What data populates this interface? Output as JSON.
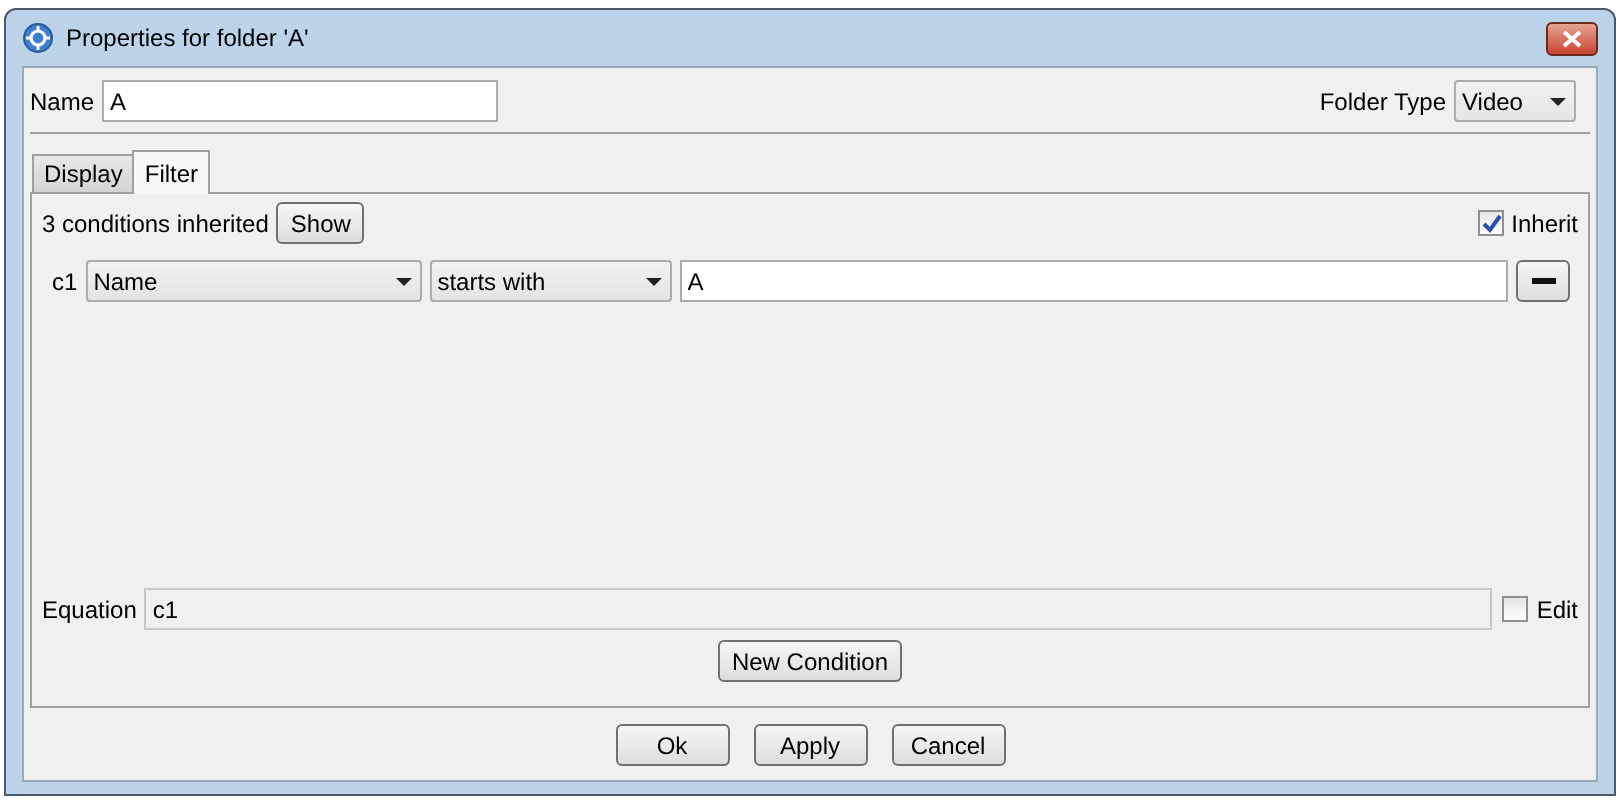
{
  "window": {
    "title": "Properties for folder 'A'"
  },
  "name_field": {
    "label": "Name",
    "value": "A"
  },
  "folder_type": {
    "label": "Folder Type",
    "value": "Video"
  },
  "tabs": [
    {
      "label": "Display",
      "selected": false
    },
    {
      "label": "Filter",
      "selected": true
    }
  ],
  "filter": {
    "inherited_text": "3 conditions inherited",
    "show_button": "Show",
    "inherit": {
      "label": "Inherit",
      "checked": true
    },
    "conditions": [
      {
        "id_label": "c1",
        "field": "Name",
        "operator": "starts with",
        "value": "A"
      }
    ],
    "equation": {
      "label": "Equation",
      "value": "c1"
    },
    "edit": {
      "label": "Edit",
      "checked": false
    },
    "new_condition_button": "New Condition"
  },
  "buttons": [
    "Ok",
    "Apply",
    "Cancel"
  ]
}
